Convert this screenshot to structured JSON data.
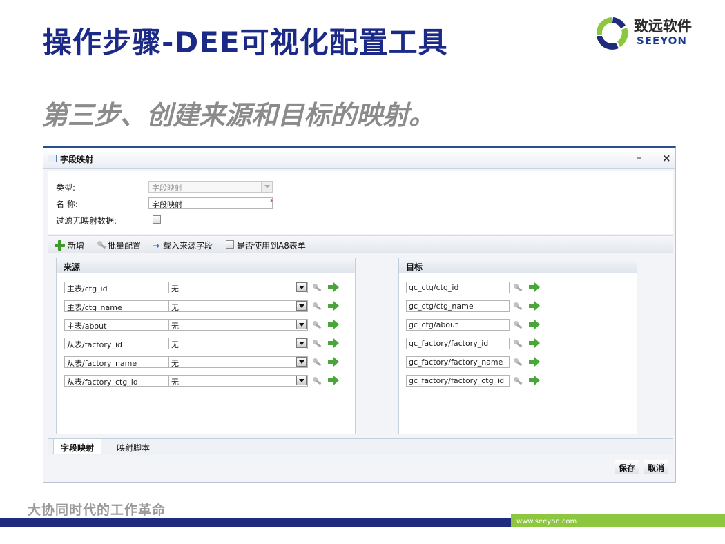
{
  "slide": {
    "title": "操作步骤-DEE可视化配置工具",
    "step": "第三步、创建来源和目标的映射。",
    "slogan": "大协同时代的工作革命",
    "url": "www.seeyon.com"
  },
  "logo": {
    "cn": "致远软件",
    "en": "SEEYON"
  },
  "colors": {
    "title": "#1b2a86",
    "step": "#8b8b8b",
    "footer_blue": "#1f2c7e",
    "footer_green": "#8dc63f",
    "add_icon": "#3e9b2a",
    "required": "#e02020"
  },
  "dialog": {
    "title": "字段映射",
    "minimize": "–",
    "close": "×",
    "form": {
      "type_label": "类型:",
      "type_value": "字段映射",
      "name_label": "名 称:",
      "name_value": "字段映射",
      "required_mark": "*",
      "filter_label": "过滤无映射数据:"
    },
    "toolbar": {
      "add": "新增",
      "batch": "批量配置",
      "load": "载入来源字段",
      "use_a8": "是否使用到A8表单"
    },
    "source": {
      "header": "来源",
      "rows": [
        {
          "field": "主表/ctg_id",
          "value": "无"
        },
        {
          "field": "主表/ctg_name",
          "value": "无"
        },
        {
          "field": "主表/about",
          "value": "无"
        },
        {
          "field": "从表/factory_id",
          "value": "无"
        },
        {
          "field": "从表/factory_name",
          "value": "无"
        },
        {
          "field": "从表/factory_ctg_id",
          "value": "无"
        }
      ]
    },
    "target": {
      "header": "目标",
      "rows": [
        {
          "field": "gc_ctg/ctg_id"
        },
        {
          "field": "gc_ctg/ctg_name"
        },
        {
          "field": "gc_ctg/about"
        },
        {
          "field": "gc_factory/factory_id"
        },
        {
          "field": "gc_factory/factory_name"
        },
        {
          "field": "gc_factory/factory_ctg_id"
        }
      ]
    },
    "tabs": [
      "字段映射",
      "映射脚本"
    ],
    "buttons": {
      "save": "保存",
      "cancel": "取消"
    }
  }
}
